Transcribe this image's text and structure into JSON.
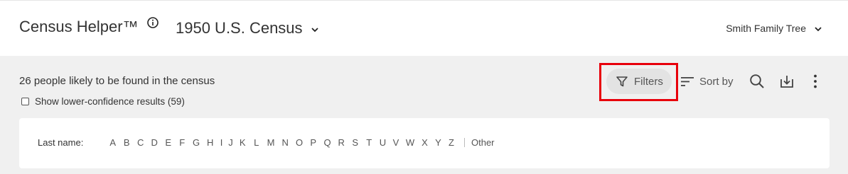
{
  "header": {
    "app_title": "Census Helper™",
    "census_select": {
      "selected": "1950 U.S. Census"
    },
    "tree_select": {
      "selected": "Smith Family Tree"
    }
  },
  "toolbar": {
    "results_summary": "26 people likely to be found in the census",
    "low_confidence_label": "Show lower-confidence results (59)",
    "low_confidence_checked": false,
    "filters_label": "Filters",
    "sort_label": "Sort by",
    "icons": [
      "filter-icon",
      "sort-icon",
      "search-icon",
      "download-icon",
      "more-vertical-icon"
    ],
    "highlight_color": "#e8000b"
  },
  "alphabet": {
    "label": "Last name:",
    "letters": [
      "A",
      "B",
      "C",
      "D",
      "E",
      "F",
      "G",
      "H",
      "I",
      "J",
      "K",
      "L",
      "M",
      "N",
      "O",
      "P",
      "Q",
      "R",
      "S",
      "T",
      "U",
      "V",
      "W",
      "X",
      "Y",
      "Z"
    ],
    "other_label": "Other"
  }
}
